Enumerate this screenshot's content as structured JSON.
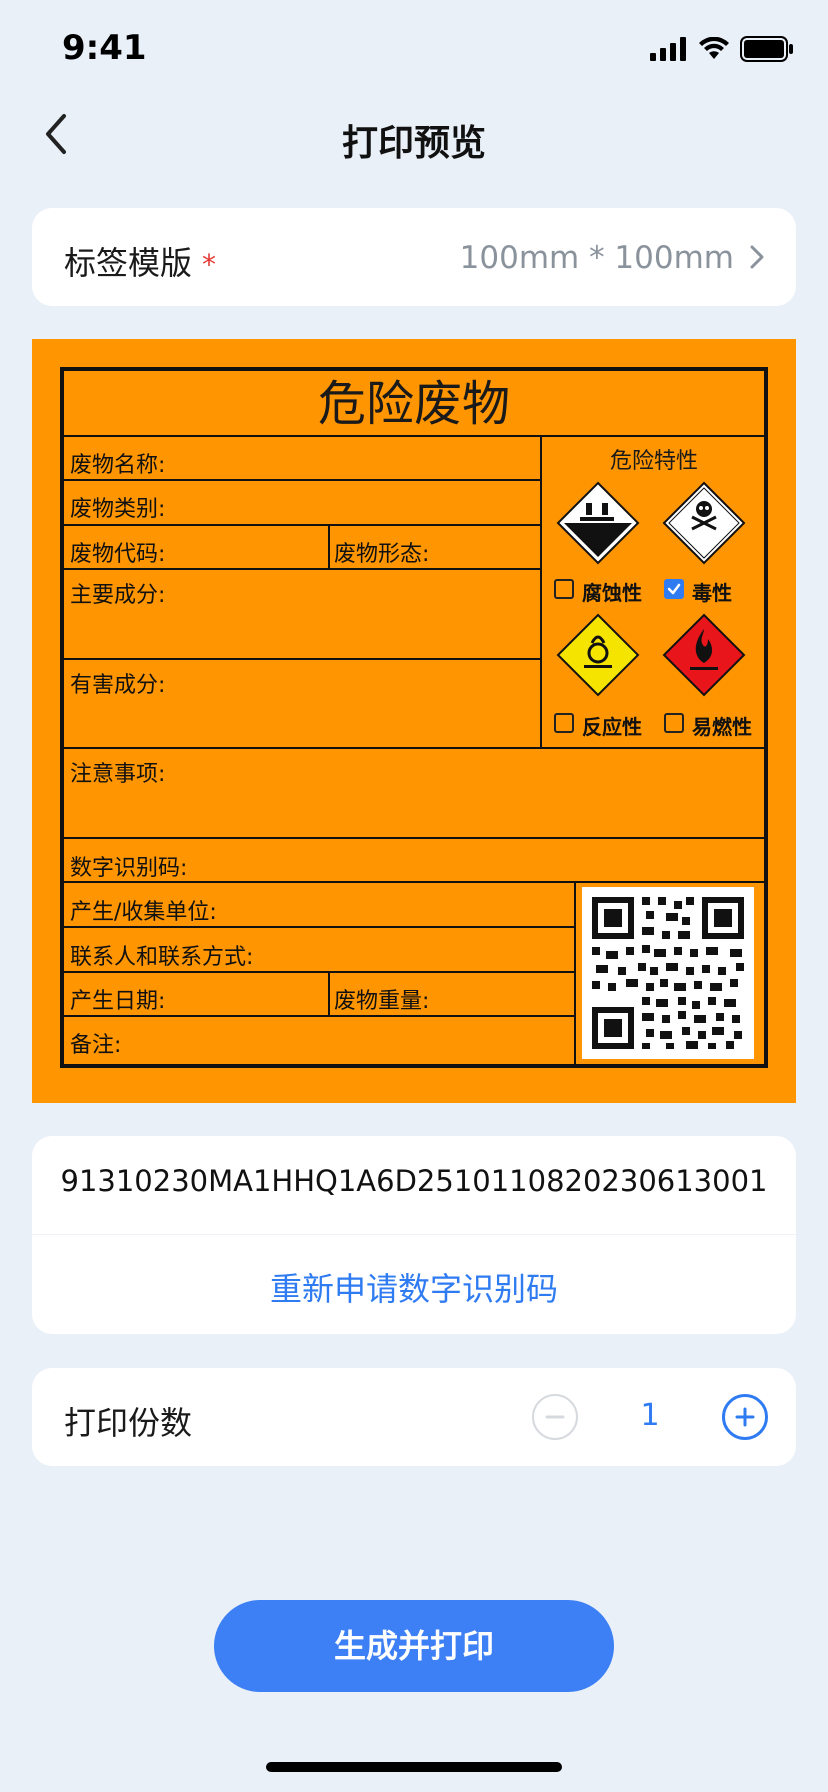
{
  "status_bar": {
    "time": "9:41"
  },
  "nav": {
    "title": "打印预览"
  },
  "template": {
    "label": "标签模版",
    "required_mark": "*",
    "value": "100mm * 100mm"
  },
  "label_card": {
    "title": "危险废物",
    "fields": {
      "waste_name": "废物名称:",
      "waste_category": "废物类别:",
      "waste_code": "废物代码:",
      "waste_form": "废物形态:",
      "main_components": "主要成分:",
      "harmful_components": "有害成分:",
      "precautions": "注意事项:",
      "digital_id": "数字识别码:",
      "producer_unit": "产生/收集单位:",
      "contact": "联系人和联系方式:",
      "production_date": "产生日期:",
      "waste_weight": "废物重量:",
      "remarks": "备注:"
    },
    "hazard_title": "危险特性",
    "hazards": [
      {
        "label": "腐蚀性",
        "checked": false,
        "icon": "corrosive-icon",
        "color": "#000000"
      },
      {
        "label": "毒性",
        "checked": true,
        "icon": "toxic-icon",
        "color": "#ffffff"
      },
      {
        "label": "反应性",
        "checked": false,
        "icon": "reactivity-icon",
        "color": "#f5e400"
      },
      {
        "label": "易燃性",
        "checked": false,
        "icon": "flammable-icon",
        "color": "#e8151b"
      }
    ],
    "background_color": "#ff9500"
  },
  "digital_code": {
    "value": "91310230MA1HHQ1A6D2510110820230613001",
    "reapply_label": "重新申请数字识别码"
  },
  "copies": {
    "label": "打印份数",
    "value": "1"
  },
  "primary_button": {
    "label": "生成并打印"
  },
  "colors": {
    "accent": "#2f7bf2",
    "background": "#eaf0f8"
  }
}
